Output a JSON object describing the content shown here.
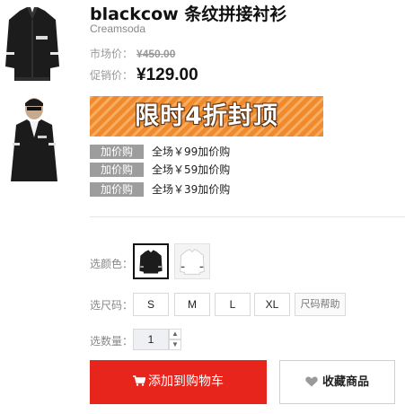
{
  "product": {
    "title": "blackcow 条纹拼接衬衫",
    "brand": "Creamsoda"
  },
  "price": {
    "market_label": "市场价：",
    "market_value": "¥450.00",
    "promo_label": "促销价：",
    "promo_value": "¥129.00"
  },
  "banner": {
    "text": "限时4折封顶"
  },
  "addons": [
    {
      "tag": "加价购",
      "text": "全场￥99加价购"
    },
    {
      "tag": "加价购",
      "text": "全场￥59加价购"
    },
    {
      "tag": "加价购",
      "text": "全场￥39加价购"
    }
  ],
  "options": {
    "color_label": "选颜色：",
    "size_label": "选尺码：",
    "qty_label": "选数量：",
    "sizes": [
      "S",
      "M",
      "L",
      "XL"
    ],
    "size_help": "尺码帮助",
    "quantity": "1"
  },
  "actions": {
    "add_to_cart": "添加到购物车",
    "favorite": "收藏商品"
  },
  "colors": {
    "accent_red": "#e8251c",
    "banner_orange": "#f08a2c",
    "tag_gray": "#9d9d9d"
  },
  "icons": [
    "jacket-thumbnail",
    "model-thumbnail",
    "cart-icon",
    "heart-icon"
  ]
}
